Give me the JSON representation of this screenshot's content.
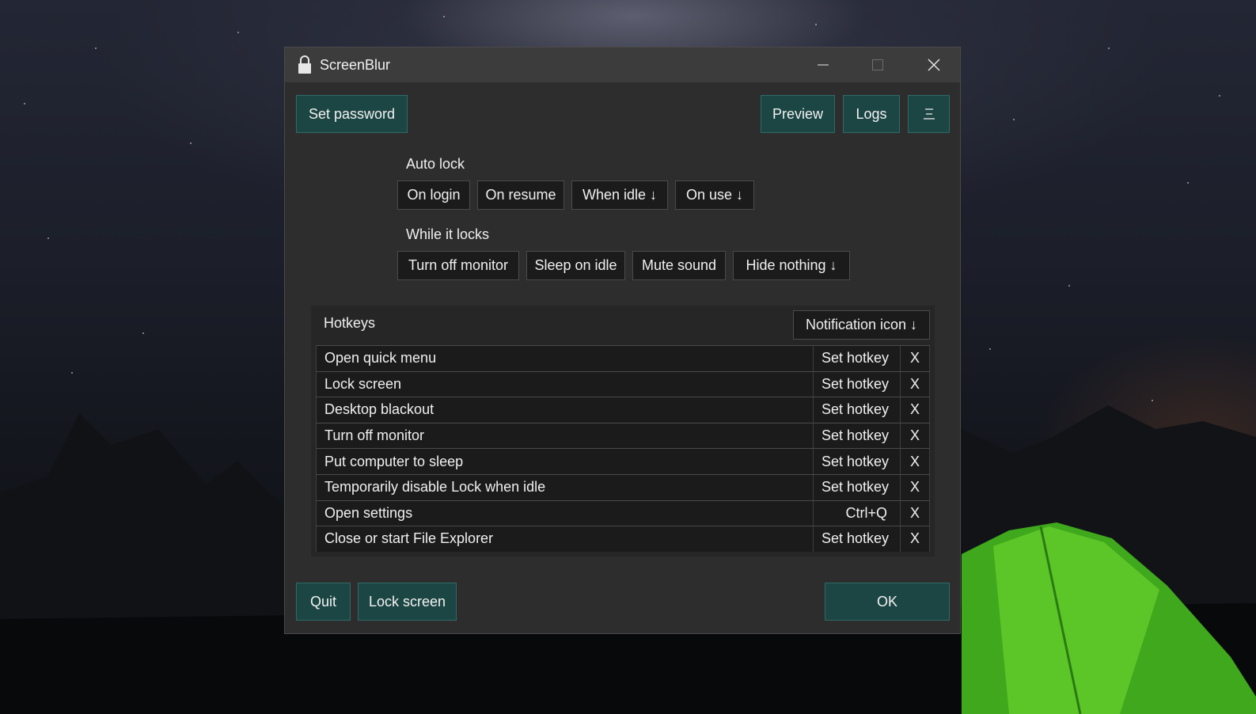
{
  "window": {
    "title": "ScreenBlur",
    "accent": "#1c4644"
  },
  "toolbar": {
    "set_password": "Set password",
    "preview": "Preview",
    "logs": "Logs",
    "menu_icon": "hamburger-menu-icon"
  },
  "auto_lock": {
    "heading": "Auto lock",
    "options": [
      "On login",
      "On resume",
      "When idle ↓",
      "On use ↓"
    ]
  },
  "while_locks": {
    "heading": "While it locks",
    "options": [
      "Turn off monitor",
      "Sleep on idle",
      "Mute sound",
      "Hide nothing ↓"
    ]
  },
  "hotkeys": {
    "heading": "Hotkeys",
    "dropdown": "Notification icon ↓",
    "rows": [
      {
        "name": "Open quick menu",
        "key": "Set hotkey",
        "clear": "X"
      },
      {
        "name": "Lock screen",
        "key": "Set hotkey",
        "clear": "X"
      },
      {
        "name": "Desktop blackout",
        "key": "Set hotkey",
        "clear": "X"
      },
      {
        "name": "Turn off monitor",
        "key": "Set hotkey",
        "clear": "X"
      },
      {
        "name": "Put computer to sleep",
        "key": "Set hotkey",
        "clear": "X"
      },
      {
        "name": "Temporarily disable Lock when idle",
        "key": "Set hotkey",
        "clear": "X"
      },
      {
        "name": "Open settings",
        "key": "Ctrl+Q",
        "clear": "X"
      },
      {
        "name": "Close or start File Explorer",
        "key": "Set hotkey",
        "clear": "X"
      }
    ]
  },
  "footer": {
    "quit": "Quit",
    "lock_screen": "Lock screen",
    "ok": "OK"
  }
}
